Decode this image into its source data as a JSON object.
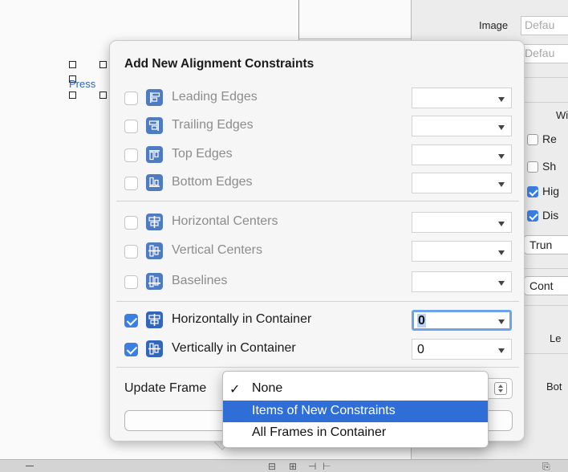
{
  "canvas": {
    "button_label": "Press"
  },
  "inspector": {
    "image_label": "Image",
    "image_value": "Defau",
    "second_value": "Defau",
    "section_partial": "Wi",
    "checks": [
      {
        "label": "Re",
        "checked": false
      },
      {
        "label": "Sh",
        "checked": false
      },
      {
        "label": "Hig",
        "checked": true
      },
      {
        "label": "Dis",
        "checked": true
      }
    ],
    "buttons": [
      "Trun",
      "Cont"
    ],
    "row_labels": [
      "Le",
      "Bot"
    ]
  },
  "popover": {
    "title": "Add New Alignment Constraints",
    "constraints": [
      {
        "label": "Leading Edges",
        "icon": "leading-edges-icon",
        "checked": false,
        "enabled": false,
        "value": ""
      },
      {
        "label": "Trailing Edges",
        "icon": "trailing-edges-icon",
        "checked": false,
        "enabled": false,
        "value": ""
      },
      {
        "label": "Top Edges",
        "icon": "top-edges-icon",
        "checked": false,
        "enabled": false,
        "value": ""
      },
      {
        "label": "Bottom Edges",
        "icon": "bottom-edges-icon",
        "checked": false,
        "enabled": false,
        "value": ""
      },
      {
        "label": "Horizontal Centers",
        "icon": "horizontal-centers-icon",
        "checked": false,
        "enabled": false,
        "value": ""
      },
      {
        "label": "Vertical Centers",
        "icon": "vertical-centers-icon",
        "checked": false,
        "enabled": false,
        "value": ""
      },
      {
        "label": "Baselines",
        "icon": "baselines-icon",
        "checked": false,
        "enabled": false,
        "value": ""
      },
      {
        "label": "Horizontally in Container",
        "icon": "horizontally-in-container-icon",
        "checked": true,
        "enabled": true,
        "value": "0"
      },
      {
        "label": "Vertically in Container",
        "icon": "vertically-in-container-icon",
        "checked": true,
        "enabled": true,
        "value": "0"
      }
    ],
    "update_frames_label": "Update Frame",
    "update_frames_options": [
      {
        "label": "None",
        "checked": true,
        "highlighted": false
      },
      {
        "label": "Items of New Constraints",
        "checked": false,
        "highlighted": true
      },
      {
        "label": "All Frames in Container",
        "checked": false,
        "highlighted": false
      }
    ],
    "check_glyph": "✓"
  },
  "colors": {
    "accent": "#3c7fe2",
    "icon_blue": "#3366b8",
    "menu_highlight": "#2f6ed6",
    "disabled_text": "#8c8c8c"
  }
}
